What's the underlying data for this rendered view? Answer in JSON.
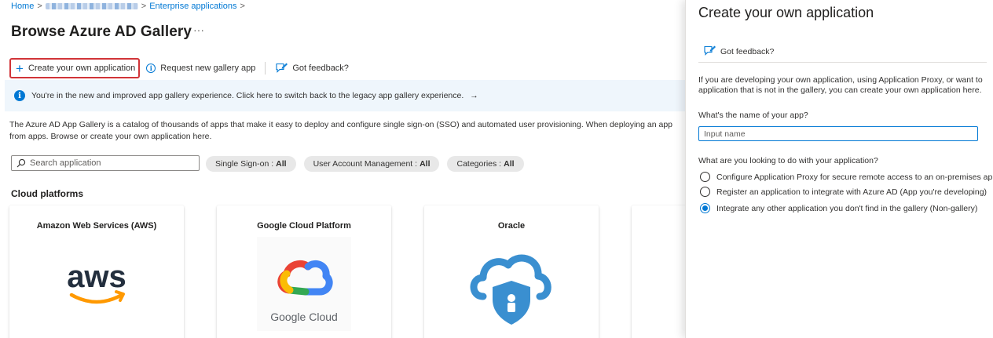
{
  "breadcrumb": {
    "home": "Home",
    "middle_redacted": "",
    "current": "Enterprise applications",
    "separator": ">"
  },
  "page": {
    "title": "Browse Azure AD Gallery",
    "more": "···"
  },
  "toolbar": {
    "create_label": "Create your own application",
    "request_label": "Request new gallery app",
    "feedback_label": "Got feedback?"
  },
  "banner": {
    "text": "You're in the new and improved app gallery experience. Click here to switch back to the legacy app gallery experience.",
    "arrow": "→"
  },
  "description": "The Azure AD App Gallery is a catalog of thousands of apps that make it easy to deploy and configure single sign-on (SSO) and automated user provisioning. When deploying an app from apps. Browse or create your own application here.",
  "search": {
    "placeholder": "Search application"
  },
  "filters": [
    {
      "label": "Single Sign-on :",
      "value": "All"
    },
    {
      "label": "User Account Management :",
      "value": "All"
    },
    {
      "label": "Categories :",
      "value": "All"
    }
  ],
  "section_title": "Cloud platforms",
  "cards": [
    {
      "title": "Amazon Web Services (AWS)",
      "logo_text": "aws"
    },
    {
      "title": "Google Cloud Platform",
      "logo_text": "Google Cloud"
    },
    {
      "title": "Oracle",
      "logo_text": ""
    }
  ],
  "panel": {
    "title": "Create your own application",
    "feedback_label": "Got feedback?",
    "intro": "If you are developing your own application, using Application Proxy, or want to application that is not in the gallery, you can create your own application here.",
    "name_question": "What's the name of your app?",
    "name_placeholder": "Input name",
    "purpose_question": "What are you looking to do with your application?",
    "options": [
      {
        "label": "Configure Application Proxy for secure remote access to an on-premises ap",
        "checked": false
      },
      {
        "label": "Register an application to integrate with Azure AD (App you're developing)",
        "checked": false
      },
      {
        "label": "Integrate any other application you don't find in the gallery (Non-gallery)",
        "checked": true
      }
    ]
  },
  "colors": {
    "accent": "#0078d4",
    "highlight_border": "#d13438",
    "banner_bg": "#eff6fc",
    "aws_orange": "#ff9900",
    "aws_text": "#232f3e",
    "oracle_blue": "#3a8fd0"
  }
}
